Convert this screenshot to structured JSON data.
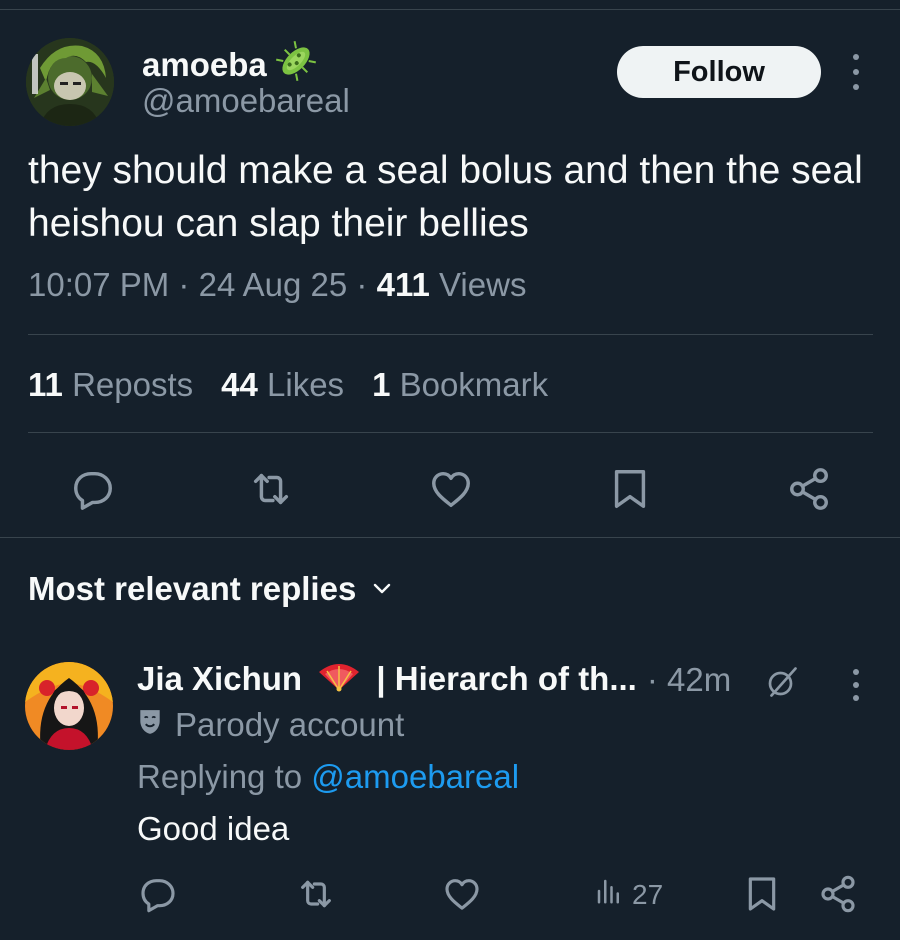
{
  "post": {
    "author": {
      "display_name": "amoeba",
      "badge_icon": "microbe-icon",
      "handle": "@amoebareal"
    },
    "follow_label": "Follow",
    "text": "they should make a seal bolus and then the seal heishou can slap their bellies",
    "time": "10:07 PM",
    "date": "24 Aug 25",
    "views_count": "411",
    "views_label": "Views",
    "stats": {
      "reposts_count": "11",
      "reposts_label": "Reposts",
      "likes_count": "44",
      "likes_label": "Likes",
      "bookmarks_count": "1",
      "bookmarks_label": "Bookmark"
    },
    "actions": [
      "reply-icon",
      "repost-icon",
      "like-icon",
      "bookmark-icon",
      "share-icon"
    ]
  },
  "replies_section": {
    "sort_label": "Most relevant replies"
  },
  "reply": {
    "name_part1": "Jia Xichun",
    "name_part2": "| Hierarch of th...",
    "emoji_icon": "fan-icon",
    "separator": "·",
    "time": "42m",
    "parody_label": "Parody account",
    "replying_prefix": "Replying to",
    "replying_to": "@amoebareal",
    "text": "Good idea",
    "views": "27"
  },
  "colors": {
    "background": "#15202b",
    "text_primary": "#f7f9f9",
    "text_secondary": "#8b98a5",
    "accent": "#1d9bf0",
    "divider": "#38444d"
  }
}
